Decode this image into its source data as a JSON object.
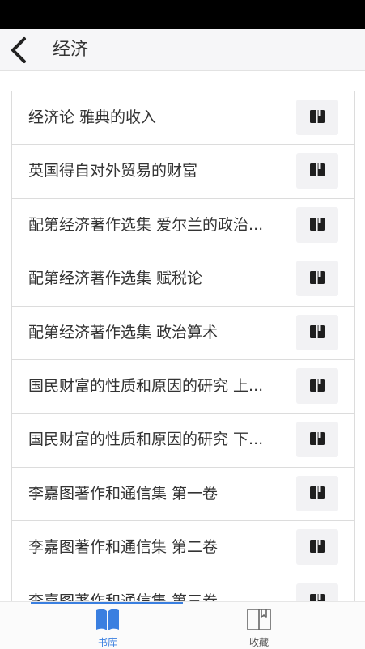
{
  "header": {
    "title": "经济"
  },
  "books": [
    {
      "label": "经济论 雅典的收入"
    },
    {
      "label": "英国得自对外贸易的财富"
    },
    {
      "label": "配第经济著作选集 爱尔兰的政治..."
    },
    {
      "label": "配第经济著作选集 赋税论"
    },
    {
      "label": "配第经济著作选集 政治算术"
    },
    {
      "label": "国民财富的性质和原因的研究 上..."
    },
    {
      "label": "国民财富的性质和原因的研究 下..."
    },
    {
      "label": "李嘉图著作和通信集 第一卷"
    },
    {
      "label": "李嘉图著作和通信集 第二卷"
    },
    {
      "label": "李嘉图著作和通信集 第三卷"
    }
  ],
  "tabbar": {
    "library_label": "书库",
    "favorites_label": "收藏"
  },
  "icons": {
    "back": "chevron-left-icon",
    "row_action": "book-icon",
    "library": "open-book-icon",
    "favorites": "bookmark-book-icon"
  },
  "colors": {
    "accent": "#3a7fe0",
    "header_bg": "#f6f6f8",
    "status_bar": "#000000"
  }
}
